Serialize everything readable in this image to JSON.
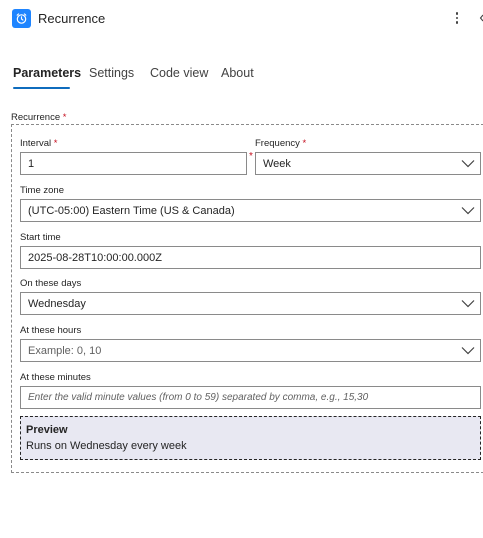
{
  "header": {
    "title": "Recurrence"
  },
  "tabs": [
    {
      "label": "Parameters"
    },
    {
      "label": "Settings"
    },
    {
      "label": "Code view"
    },
    {
      "label": "About"
    }
  ],
  "recurrence": {
    "label": "Recurrence",
    "required_mark": "*",
    "interval": {
      "label": "Interval",
      "value": "1"
    },
    "frequency": {
      "label": "Frequency",
      "value": "Week"
    },
    "time_zone": {
      "label": "Time zone",
      "value": "(UTC-05:00) Eastern Time (US & Canada)"
    },
    "start_time": {
      "label": "Start time",
      "value": "2025-08-28T10:00:00.000Z"
    },
    "on_these_days": {
      "label": "On these days",
      "value": "Wednesday"
    },
    "at_these_hours": {
      "label": "At these hours",
      "placeholder": "Example: 0, 10"
    },
    "at_these_minutes": {
      "label": "At these minutes",
      "placeholder": "Enter the valid minute values (from 0 to 59) separated by comma, e.g., 15,30"
    }
  },
  "preview": {
    "title": "Preview",
    "text": "Runs on Wednesday every week"
  },
  "colors": {
    "accent": "#0f6cbd",
    "app_icon": "#1f85ff",
    "required": "#c50f1f",
    "preview_bg": "#e8e8f2"
  },
  "icons": [
    "alarm-clock-icon",
    "more-vertical-icon",
    "chevron-down-icon"
  ]
}
